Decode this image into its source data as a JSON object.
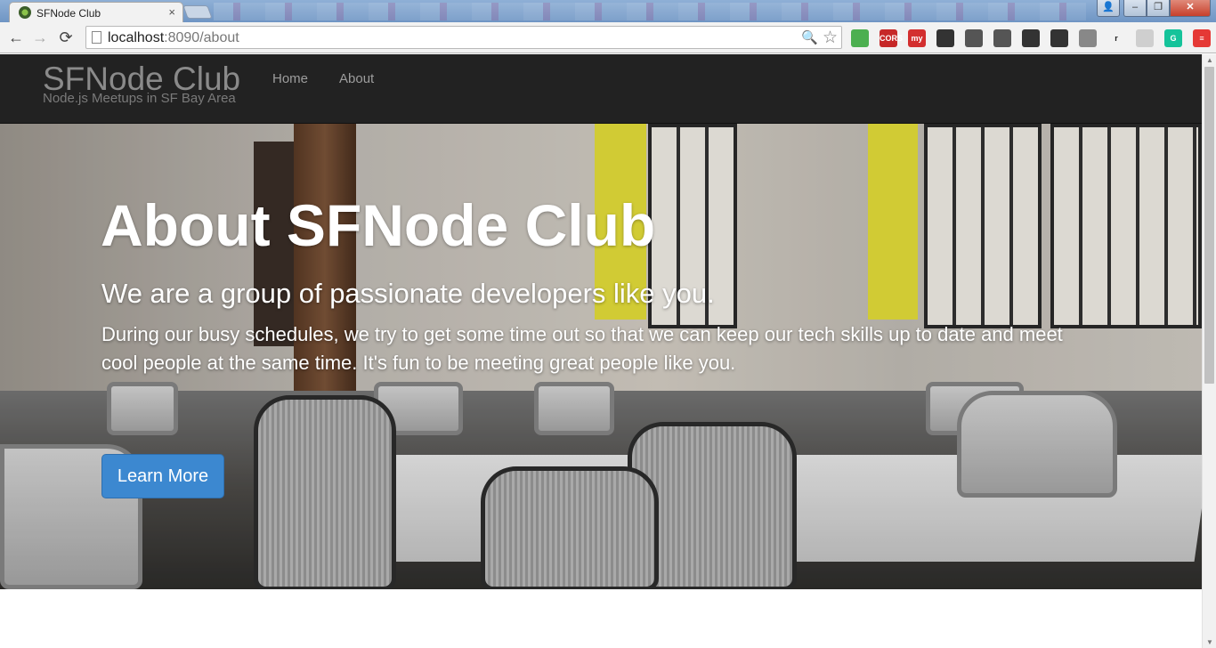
{
  "browser": {
    "tab_title": "SFNode Club",
    "tab_close": "×",
    "url_host": "localhost",
    "url_path": ":8090/about",
    "back": "←",
    "forward": "→",
    "reload": "⟳",
    "zoom": "🔍",
    "bookmark_star": "☆",
    "window": {
      "minimize": "–",
      "maximize": "❐",
      "close": "✕"
    },
    "extensions": [
      {
        "name": "leaf-extension",
        "label": "",
        "color": "#4caf50"
      },
      {
        "name": "cors-extension",
        "label": "CORS",
        "color": "#c62828"
      },
      {
        "name": "my-extension",
        "label": "my",
        "color": "#d32f2f"
      },
      {
        "name": "owl-extension",
        "label": "",
        "color": "#333333"
      },
      {
        "name": "cast-extension",
        "label": "",
        "color": "#555555"
      },
      {
        "name": "screen-extension",
        "label": "",
        "color": "#555555"
      },
      {
        "name": "compass-extension",
        "label": "",
        "color": "#333333"
      },
      {
        "name": "evernote-extension",
        "label": "",
        "color": "#333333"
      },
      {
        "name": "copy-extension",
        "label": "",
        "color": "#888888"
      },
      {
        "name": "r-extension",
        "label": "r",
        "color": "#f2f2f2"
      },
      {
        "name": "note-extension",
        "label": "",
        "color": "#cfcfcf"
      },
      {
        "name": "grammarly-extension",
        "label": "G",
        "color": "#15c39a"
      },
      {
        "name": "menu-extension",
        "label": "≡",
        "color": "#e53935"
      }
    ]
  },
  "site": {
    "brand": "SFNode Club",
    "tagline": "Node.js Meetups in SF Bay Area",
    "nav": [
      {
        "label": "Home"
      },
      {
        "label": "About"
      }
    ]
  },
  "hero": {
    "title": "About SFNode Club",
    "lead": "We are a group of passionate developers like you.",
    "text": "During our busy schedules, we try to get some time out so that we can keep our tech skills up to date and meet cool people at the same time. It's fun to be meeting great people like you.",
    "button": "Learn More"
  }
}
